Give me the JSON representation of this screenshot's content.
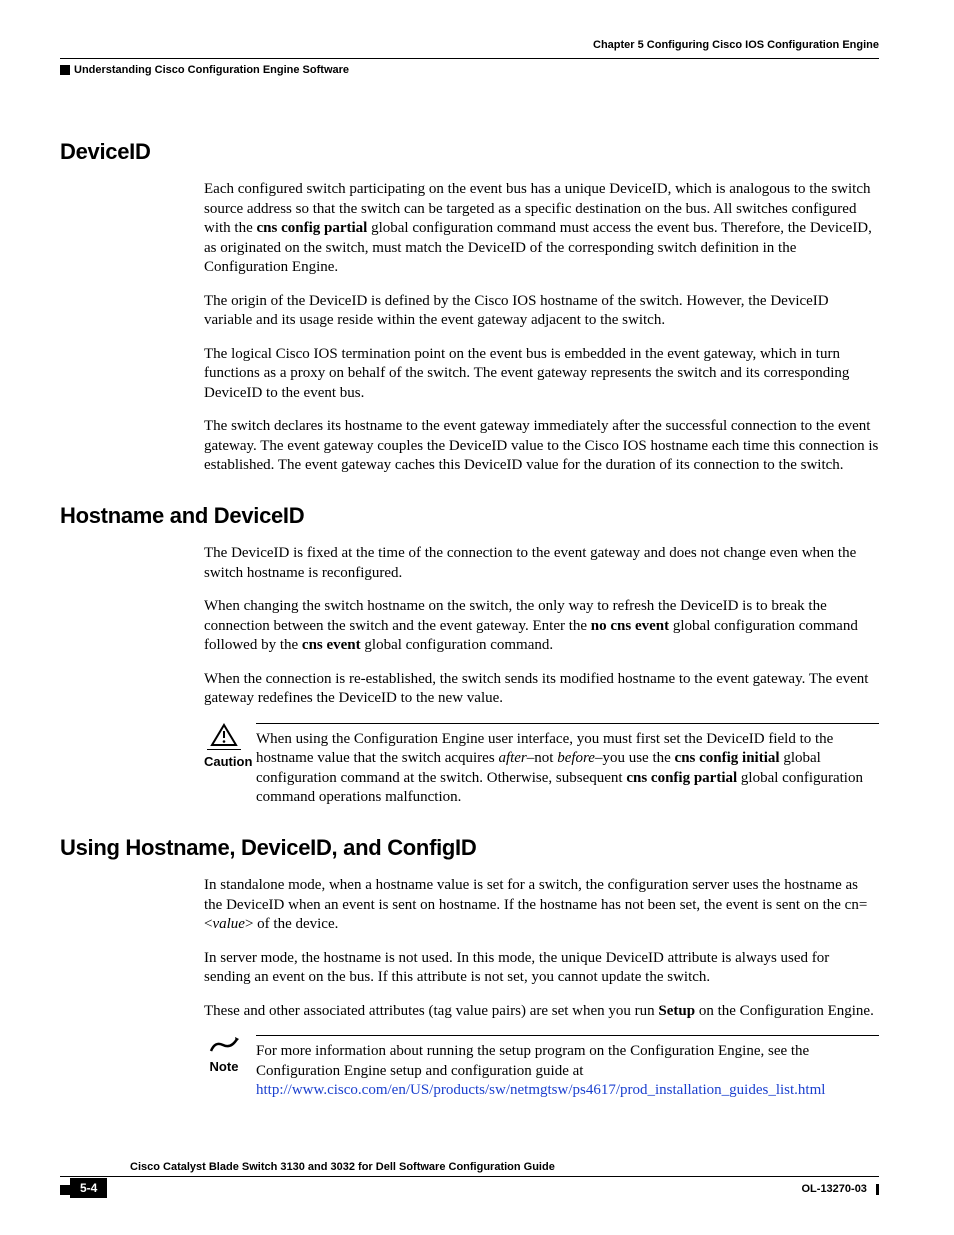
{
  "header": {
    "chapter": "Chapter 5      Configuring Cisco IOS Configuration Engine",
    "section": "Understanding Cisco Configuration Engine Software"
  },
  "sections": {
    "s1": {
      "title": "DeviceID",
      "p1a": "Each configured switch participating on the event bus has a unique DeviceID, which is analogous to the switch source address so that the switch can be targeted as a specific destination on the bus. All switches configured with the ",
      "p1b_bold": "cns config partial",
      "p1c": " global configuration command must access the event bus. Therefore, the DeviceID, as originated on the switch, must match the DeviceID of the corresponding switch definition in the Configuration Engine.",
      "p2": "The origin of the DeviceID is defined by the Cisco IOS hostname of the switch. However, the DeviceID variable and its usage reside within the event gateway adjacent to the switch.",
      "p3": "The logical Cisco IOS termination point on the event bus is embedded in the event gateway, which in turn functions as a proxy on behalf of the switch. The event gateway represents the switch and its corresponding DeviceID to the event bus.",
      "p4": "The switch declares its hostname to the event gateway immediately after the successful connection to the event gateway. The event gateway couples the DeviceID value to the Cisco IOS hostname each time this connection is established. The event gateway caches this DeviceID value for the duration of its connection to the switch."
    },
    "s2": {
      "title": "Hostname and DeviceID",
      "p1": "The DeviceID is fixed at the time of the connection to the event gateway and does not change even when the switch hostname is reconfigured.",
      "p2a": "When changing the switch hostname on the switch, the only way to refresh the DeviceID is to break the connection between the switch and the event gateway. Enter the ",
      "p2b_bold": "no cns event",
      "p2c": " global configuration command followed by the ",
      "p2d_bold": "cns event",
      "p2e": " global configuration command.",
      "p3": "When the connection is re-established, the switch sends its modified hostname to the event gateway. The event gateway redefines the DeviceID to the new value.",
      "caution_label": "Caution",
      "caution_a": "When using the Configuration Engine user interface, you must first set the DeviceID field to the hostname value that the switch acquires ",
      "caution_after": "after",
      "caution_dash1": "–not ",
      "caution_before": "before",
      "caution_dash2": "–you use the ",
      "caution_bold1": "cns config initial",
      "caution_mid": " global configuration command at the switch. Otherwise, subsequent ",
      "caution_bold2": "cns config partial",
      "caution_end": " global configuration command operations malfunction."
    },
    "s3": {
      "title": "Using Hostname, DeviceID, and ConfigID",
      "p1a": "In standalone mode, when a hostname value is set for a switch, the configuration server uses the hostname as the DeviceID when an event is sent on hostname. If the hostname has not been set, the event is sent on the cn=<",
      "p1b_italic": "value",
      "p1c": "> of the device.",
      "p2": "In server mode, the hostname is not used. In this mode, the unique DeviceID attribute is always used for sending an event on the bus. If this attribute is not set, you cannot update the switch.",
      "p3a": "These and other associated attributes (tag value pairs) are set when you run ",
      "p3b_bold": "Setup",
      "p3c": " on the Configuration Engine.",
      "note_label": "Note",
      "note_a": "For more information about running the setup program on the Configuration Engine, see the Configuration Engine setup and configuration guide at ",
      "note_link": "http://www.cisco.com/en/US/products/sw/netmgtsw/ps4617/prod_installation_guides_list.html"
    }
  },
  "footer": {
    "book": "Cisco Catalyst Blade Switch 3130 and 3032 for Dell Software Configuration Guide",
    "page": "5-4",
    "docnum": "OL-13270-03"
  }
}
